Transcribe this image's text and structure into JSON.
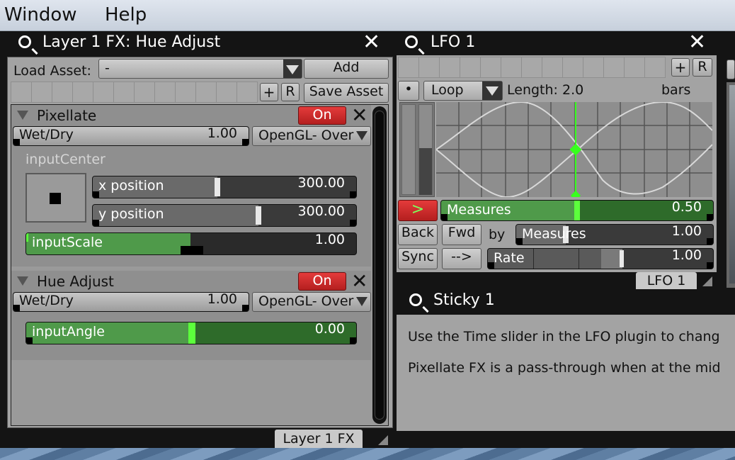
{
  "menubar": {
    "items": [
      "Window",
      "Help"
    ]
  },
  "layer_fx": {
    "title": "Layer 1 FX: Hue Adjust",
    "load_asset_label": "Load Asset:",
    "load_asset_value": "-",
    "add_label": "Add",
    "plus_label": "+",
    "r_label": "R",
    "save_asset_label": "Save Asset",
    "tab_label": "Layer 1 FX",
    "effects": [
      {
        "name": "Pixellate",
        "on_label": "On",
        "wetdry_label": "Wet/Dry",
        "wetdry_value": "1.00",
        "blend_value": "OpenGL- Over",
        "group_label": "inputCenter",
        "x_label": "x position",
        "x_value": "300.00",
        "y_label": "y position",
        "y_value": "300.00",
        "scale_label": "inputScale",
        "scale_value": "1.00"
      },
      {
        "name": "Hue Adjust",
        "on_label": "On",
        "wetdry_label": "Wet/Dry",
        "wetdry_value": "1.00",
        "blend_value": "OpenGL- Over",
        "angle_label": "inputAngle",
        "angle_value": "0.00"
      }
    ]
  },
  "lfo": {
    "title": "LFO 1",
    "plus_label": "+",
    "r_label": "R",
    "dot_label": "•",
    "loop_value": "Loop",
    "length_label": "Length: 2.0",
    "bars_label": "bars",
    "play_label": ">",
    "measures_label": "Measures",
    "measures_value": "0.50",
    "measures_progress": 0.5,
    "back_label": "Back",
    "fwd_label": "Fwd",
    "by_label": "by",
    "by_measures_label": "Measures",
    "by_measures_value": "1.00",
    "sync_label": "Sync",
    "arrow_label": "-->",
    "rate_label": "Rate",
    "rate_value": "1.00",
    "tab_label": "LFO 1"
  },
  "sticky": {
    "title": "Sticky 1",
    "line1": "Use the Time slider in the LFO plugin to chang",
    "line2": "Pixellate FX is a pass-through when at the mid"
  },
  "colors": {
    "green_fill": "#4f9a4a",
    "red_on": "#d02a2a",
    "lfo_cursor": "#37ff1e"
  }
}
